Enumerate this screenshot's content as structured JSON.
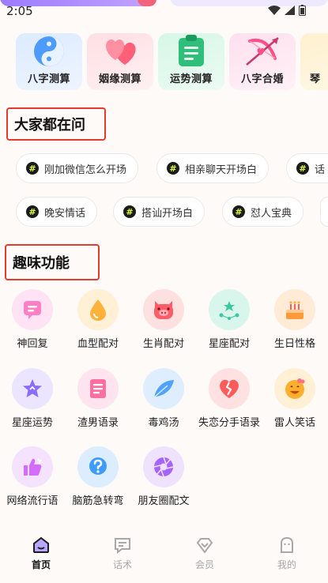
{
  "status_bar": {
    "time": "2:05"
  },
  "feature_cards": [
    {
      "label": "八字测算",
      "icon": "yin-yang-icon",
      "color": "#5aa7ff"
    },
    {
      "label": "姻缘测算",
      "icon": "hearts-icon",
      "color": "#ff6f86"
    },
    {
      "label": "运势测算",
      "icon": "clipboard-icon",
      "color": "#36c37d"
    },
    {
      "label": "八字合婚",
      "icon": "cupid-bow-icon",
      "color": "#ff5a8f"
    },
    {
      "label": "琴",
      "icon": "partial-card-icon",
      "color": "#f5b446"
    }
  ],
  "section_hot": {
    "title": "大家都在问",
    "chips_row1": [
      "刚加微信怎么开场",
      "相亲聊天开场白",
      "话"
    ],
    "chips_row2": [
      "晚安情话",
      "搭讪开场白",
      "怼人宝典"
    ],
    "chip_icon": "hashtag-icon"
  },
  "section_fun": {
    "title": "趣味功能",
    "items": [
      {
        "label": "神回复",
        "icon": "chat-icon",
        "color": "#ff7fc7"
      },
      {
        "label": "血型配对",
        "icon": "blood-drop-icon",
        "color": "#ffb23a"
      },
      {
        "label": "生肖配对",
        "icon": "pig-icon",
        "color": "#ff5c67"
      },
      {
        "label": "星座配对",
        "icon": "constellation-icon",
        "color": "#3cc7a1"
      },
      {
        "label": "生日性格",
        "icon": "cake-icon",
        "color": "#ff9a3c"
      },
      {
        "label": "星座运势",
        "icon": "star-icon",
        "color": "#8b6cff"
      },
      {
        "label": "渣男语录",
        "icon": "notebook-icon",
        "color": "#ff6fa0"
      },
      {
        "label": "毒鸡汤",
        "icon": "feather-icon",
        "color": "#4fa3ff"
      },
      {
        "label": "失恋分手语录",
        "icon": "broken-heart-icon",
        "color": "#ff5b5b"
      },
      {
        "label": "雷人笑话",
        "icon": "laugh-face-icon",
        "color": "#ffae2e"
      },
      {
        "label": "网络流行语",
        "icon": "thumbs-up-icon",
        "color": "#d46cff"
      },
      {
        "label": "脑筋急转弯",
        "icon": "question-icon",
        "color": "#3d9cff"
      },
      {
        "label": "朋友圈配文",
        "icon": "aperture-icon",
        "color": "#a563ff"
      }
    ]
  },
  "tab_bar": [
    {
      "label": "首页",
      "icon": "home-icon",
      "active": true
    },
    {
      "label": "话术",
      "icon": "speech-icon",
      "active": false
    },
    {
      "label": "会员",
      "icon": "diamond-icon",
      "active": false
    },
    {
      "label": "我的",
      "icon": "profile-icon",
      "active": false
    }
  ]
}
